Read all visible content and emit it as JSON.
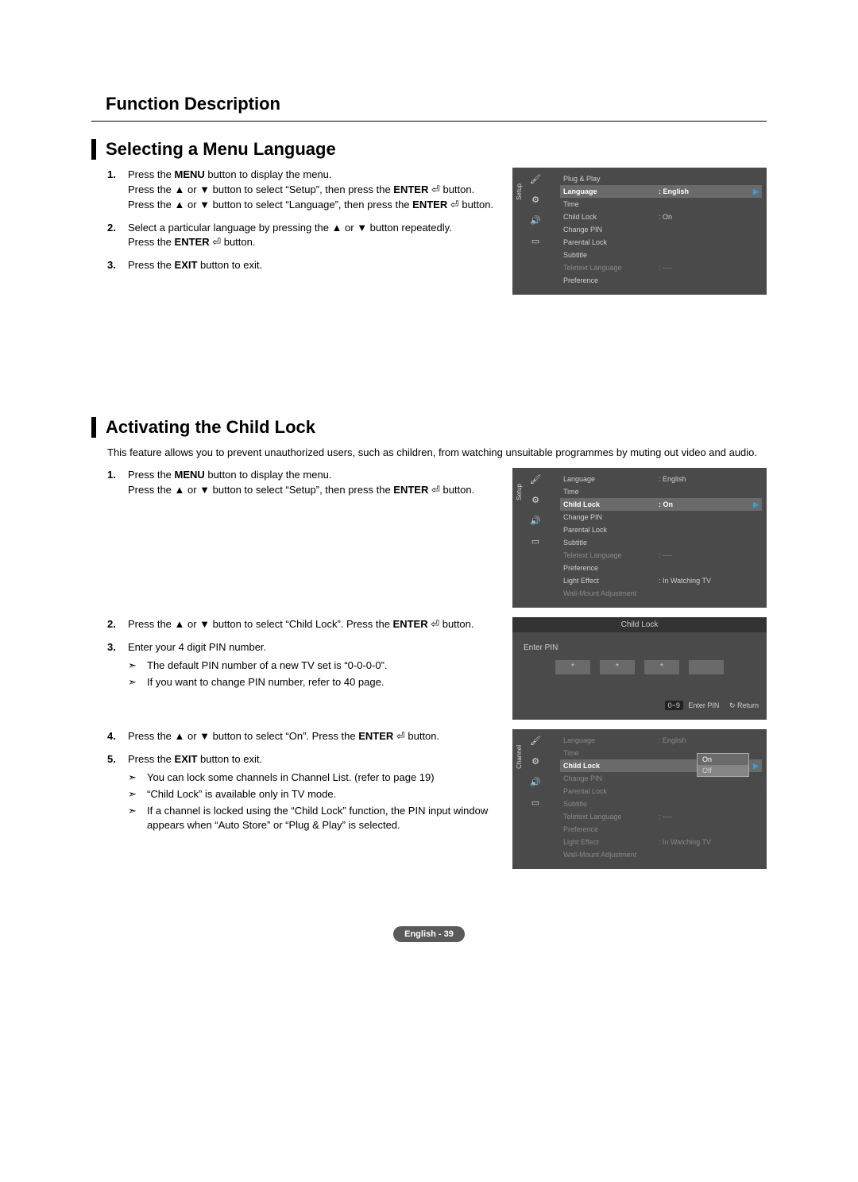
{
  "main_title": "Function Description",
  "sec1": {
    "title": "Selecting a Menu Language",
    "steps": [
      {
        "num": "1.",
        "html": "Press the <b>MENU</b> button to display the menu.<br>Press the ▲ or ▼ button to select “Setup”, then press the <b>ENTER</b> ⏎ button.<br>Press the ▲ or ▼ button to select “Language”, then press the <b>ENTER</b> ⏎ button."
      },
      {
        "num": "2.",
        "html": "Select a particular language by pressing the ▲ or ▼ button repeatedly.<br>Press the <b>ENTER</b> ⏎ button."
      },
      {
        "num": "3.",
        "html": "Press the <b>EXIT</b> button to exit."
      }
    ]
  },
  "sec2": {
    "title": "Activating the Child Lock",
    "intro": "This feature allows you to prevent unauthorized users, such as children, from watching unsuitable programmes by muting out video and audio.",
    "step1": {
      "num": "1.",
      "html": "Press the <b>MENU</b> button to display the menu.<br>Press the ▲ or ▼ button to select “Setup”, then press the <b>ENTER</b> ⏎ button."
    },
    "step2": {
      "num": "2.",
      "html": "Press the ▲ or ▼ button to select “Child Lock”. Press the <b>ENTER</b> ⏎ button."
    },
    "step3": {
      "num": "3.",
      "html": "Enter your 4 digit PIN number.",
      "notes": [
        "The default PIN number of a new TV set is “0-0-0-0”.",
        "If you want to change PIN number, refer to 40 page."
      ]
    },
    "step4": {
      "num": "4.",
      "html": "Press the ▲ or ▼ button to select “On”. Press the <b>ENTER</b> ⏎ button."
    },
    "step5": {
      "num": "5.",
      "html": "Press the <b>EXIT</b> button to exit.",
      "notes": [
        "You can lock some channels in Channel List. (refer to page 19)",
        "“Child Lock” is available only in TV mode.",
        "If a channel is locked using the “Child Lock” function, the PIN input window appears when “Auto Store” or “Plug & Play” is selected."
      ]
    }
  },
  "osd1": {
    "side": "Setup",
    "items": [
      {
        "lbl": "Plug & Play",
        "val": ""
      },
      {
        "lbl": "Language",
        "val": ": English",
        "hl": true
      },
      {
        "lbl": "Time",
        "val": ""
      },
      {
        "lbl": "Child Lock",
        "val": ": On"
      },
      {
        "lbl": "Change PIN",
        "val": ""
      },
      {
        "lbl": "Parental Lock",
        "val": ""
      },
      {
        "lbl": "Subtitle",
        "val": ""
      },
      {
        "lbl": "Teletext Language",
        "val": ": ----",
        "dim": true
      },
      {
        "lbl": "Preference",
        "val": ""
      }
    ]
  },
  "osd2": {
    "side": "Setup",
    "items": [
      {
        "lbl": "Language",
        "val": ": English"
      },
      {
        "lbl": "Time",
        "val": ""
      },
      {
        "lbl": "Child Lock",
        "val": ": On",
        "hl": true
      },
      {
        "lbl": "Change PIN",
        "val": ""
      },
      {
        "lbl": "Parental Lock",
        "val": ""
      },
      {
        "lbl": "Subtitle",
        "val": ""
      },
      {
        "lbl": "Teletext Language",
        "val": ": ----",
        "dim": true
      },
      {
        "lbl": "Preference",
        "val": ""
      },
      {
        "lbl": "Light Effect",
        "val": ": In Watching TV"
      },
      {
        "lbl": "Wall-Mount Adjustment",
        "val": "",
        "dim": true
      }
    ]
  },
  "osd_pin": {
    "title": "Child Lock",
    "label": "Enter PIN",
    "dots": [
      "*",
      "*",
      "*",
      ""
    ],
    "foot_btn": "0~9",
    "foot_enter": "Enter PIN",
    "foot_return": "↻ Return"
  },
  "osd3": {
    "side": "Channel",
    "items": [
      {
        "lbl": "Language",
        "val": ": English",
        "dim": true
      },
      {
        "lbl": "Time",
        "val": "",
        "dim": true
      },
      {
        "lbl": "Child Lock",
        "val": "",
        "hl": true
      },
      {
        "lbl": "Change PIN",
        "val": "",
        "dim": true
      },
      {
        "lbl": "Parental Lock",
        "val": "",
        "dim": true
      },
      {
        "lbl": "Subtitle",
        "val": "",
        "dim": true
      },
      {
        "lbl": "Teletext Language",
        "val": ": ----",
        "dim": true
      },
      {
        "lbl": "Preference",
        "val": "",
        "dim": true
      },
      {
        "lbl": "Light Effect",
        "val": ": In Watching TV",
        "dim": true
      },
      {
        "lbl": "Wall-Mount Adjustment",
        "val": "",
        "dim": true
      }
    ],
    "options": [
      "On",
      "Off"
    ],
    "sel": "On"
  },
  "footer": "English - 39"
}
